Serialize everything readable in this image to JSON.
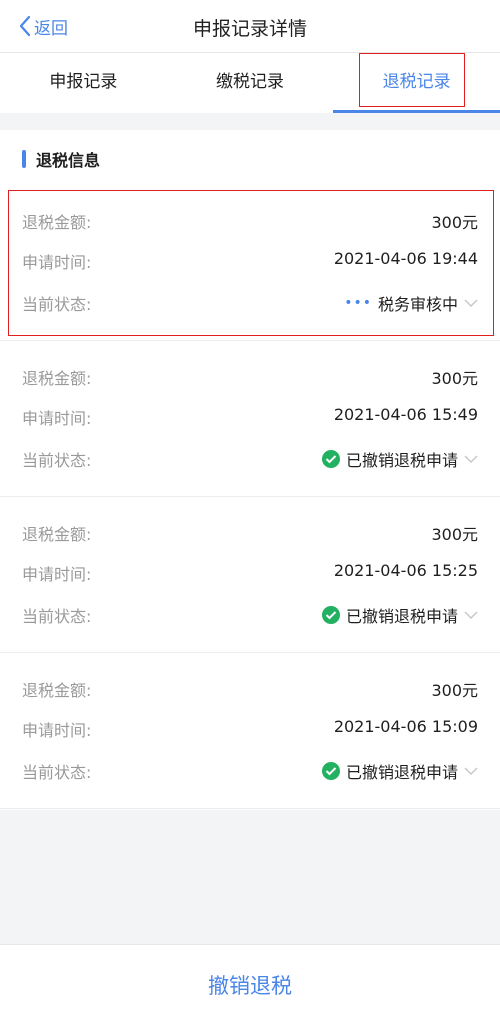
{
  "navbar": {
    "back_label": "返回",
    "title": "申报记录详情"
  },
  "tabs": [
    {
      "label": "申报记录",
      "active": false
    },
    {
      "label": "缴税记录",
      "active": false
    },
    {
      "label": "退税记录",
      "active": true
    }
  ],
  "section": {
    "title": "退税信息"
  },
  "labels": {
    "amount": "退税金额:",
    "time": "申请时间:",
    "status": "当前状态:"
  },
  "records": [
    {
      "amount": "300元",
      "time": "2021-04-06 19:44",
      "status": "税务审核中",
      "status_icon": "dots-icon",
      "status_color": "#4a86e8"
    },
    {
      "amount": "300元",
      "time": "2021-04-06 15:49",
      "status": "已撤销退税申请",
      "status_icon": "check-circle-icon",
      "status_color": "#22b061"
    },
    {
      "amount": "300元",
      "time": "2021-04-06 15:25",
      "status": "已撤销退税申请",
      "status_icon": "check-circle-icon",
      "status_color": "#22b061"
    },
    {
      "amount": "300元",
      "time": "2021-04-06 15:09",
      "status": "已撤销退税申请",
      "status_icon": "check-circle-icon",
      "status_color": "#22b061"
    }
  ],
  "footer": {
    "button_label": "撤销退税"
  },
  "colors": {
    "accent": "#4a86e8",
    "success": "#22b061",
    "highlight": "#e02020"
  }
}
